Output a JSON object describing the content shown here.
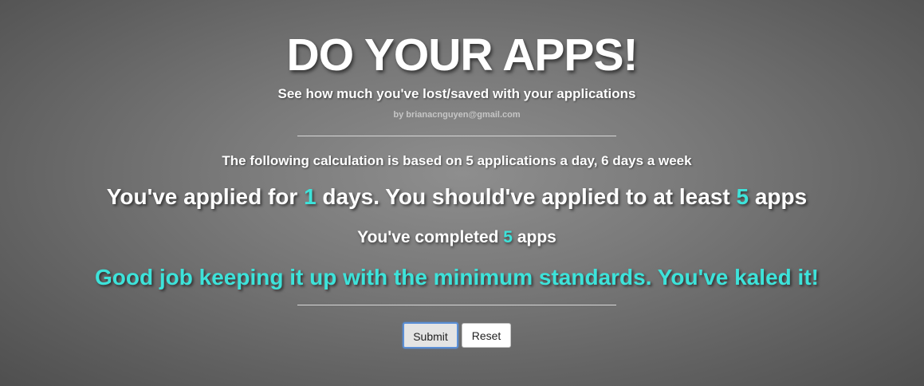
{
  "header": {
    "title": "DO YOUR APPS!",
    "subtitle": "See how much you've lost/saved with your applications",
    "byline": "by brianacnguyen@gmail.com"
  },
  "summary": {
    "basis": "The following calculation is based on 5 applications a day, 6 days a week",
    "applied_prefix": "You've applied for ",
    "days_applied": "1",
    "applied_middle": " days. You should've applied to at least ",
    "apps_expected": "5",
    "applied_suffix": " apps",
    "completed_prefix": "You've completed ",
    "apps_completed": "5",
    "completed_suffix": " apps",
    "message": "Good job keeping it up with the minimum standards. You've kaled it!"
  },
  "actions": {
    "submit_label": "Submit",
    "reset_label": "Reset"
  },
  "colors": {
    "accent": "#3de3da",
    "text": "#ffffff",
    "focus_ring": "#5b8fd6"
  }
}
